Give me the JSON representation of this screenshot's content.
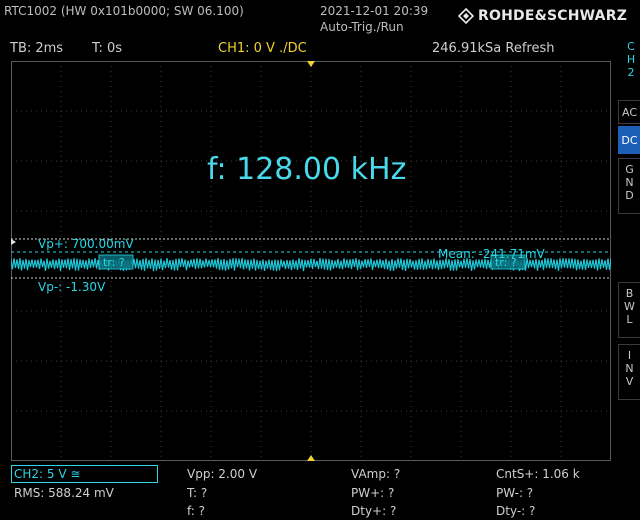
{
  "header": {
    "model": "RTC1002 (HW 0x101b0000; SW 06.100)",
    "datetime": "2021-12-01 20:39",
    "mode": "Auto-Trig./Run",
    "brand": "ROHDE&SCHWARZ"
  },
  "status": {
    "timebase": "TB: 2ms",
    "trigger_pos": "T: 0s",
    "ch1": "CH1: 0 V ./DC",
    "sample_rate": "246.91kSa Refresh"
  },
  "display": {
    "frequency": "f: 128.00 kHz",
    "vp_plus": "Vp+: 700.00mV",
    "vp_minus": "Vp-: -1.30V",
    "mean": "Mean: -241.71mV",
    "channel_marker": "2",
    "cursor_left": "tr: ?",
    "cursor_right": "tr: ?"
  },
  "colors": {
    "trace": "#1ec8d8",
    "ch1": "#f0d330",
    "grid": "#3c3c3c",
    "active_button": "#1d5fb8"
  },
  "side_menu": {
    "channel_label": "CH 2",
    "ac": "AC",
    "dc": "DC",
    "gnd": "G N D",
    "bwl": "B W L",
    "inv": "I N V"
  },
  "measurements": {
    "ch2": "CH2: 5 V ≅",
    "rms": "RMS: 588.24 mV",
    "vpp": "Vpp: 2.00 V",
    "t": "T: ?",
    "f": "f: ?",
    "vamp": "VAmp: ?",
    "pw_plus": "PW+: ?",
    "dty_plus": "Dty+: ?",
    "cnts_plus": "CntS+: 1.06 k",
    "pw_minus": "PW-: ?",
    "dty_minus": "Dty-: ?"
  }
}
